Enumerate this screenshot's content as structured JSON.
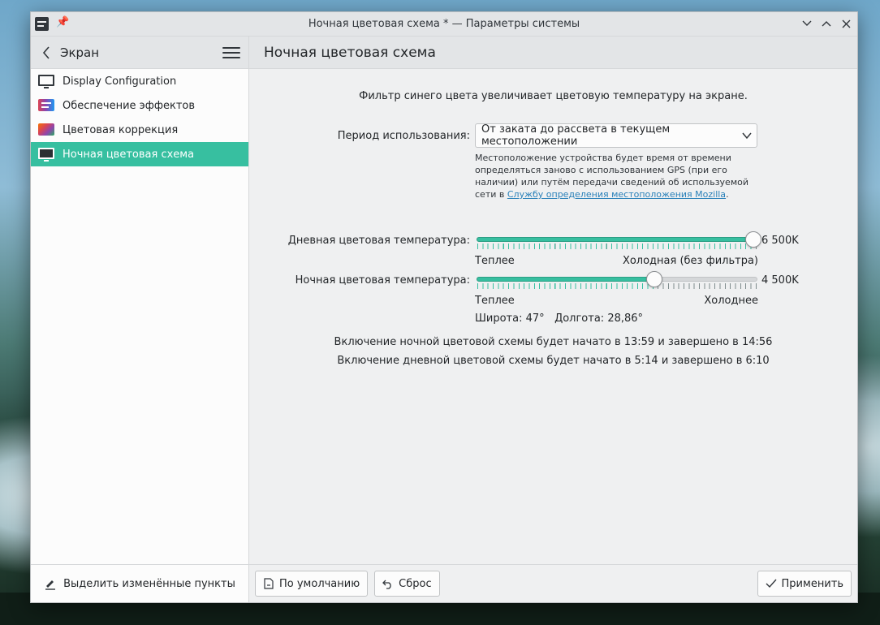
{
  "window": {
    "title": "Ночная цветовая схема * — Параметры системы"
  },
  "sidebar": {
    "back_title": "Экран",
    "items": [
      {
        "label": "Display Configuration",
        "icon": "monitor-icon"
      },
      {
        "label": "Обеспечение эффектов",
        "icon": "effects-icon"
      },
      {
        "label": "Цветовая коррекция",
        "icon": "color-correction-icon"
      },
      {
        "label": "Ночная цветовая схема",
        "icon": "monitor-icon",
        "active": true
      }
    ],
    "footer_button": "Выделить изменённые пункты"
  },
  "main": {
    "page_title": "Ночная цветовая схема",
    "description": "Фильтр синего цвета увеличивает цветовую температуру на экране.",
    "period_label": "Период использования:",
    "period_value": "От заката до рассвета в текущем местоположении",
    "location_note": "Местоположение устройства будет время от времени определяться заново с использованием GPS (при его наличии) или путём передачи сведений об используемой сети в",
    "location_link": "Службу определения местоположения Mozilla",
    "location_period": ".",
    "day_temp": {
      "label": "Дневная цветовая температура:",
      "value_text": "6 500K",
      "value": 6500,
      "min": 1000,
      "max": 6500,
      "left_caption": "Теплее",
      "right_caption": "Холодная (без фильтра)"
    },
    "night_temp": {
      "label": "Ночная цветовая температура:",
      "value_text": "4 500K",
      "value": 4500,
      "min": 1000,
      "max": 6500,
      "left_caption": "Теплее",
      "right_caption": "Холоднее"
    },
    "latitude": "Широта: 47°",
    "longitude": "Долгота: 28,86°",
    "night_schedule": "Включение ночной цветовой схемы будет начато в 13:59 и завершено в 14:56",
    "day_schedule": "Включение дневной цветовой схемы будет начато в 5:14 и завершено в 6:10",
    "buttons": {
      "defaults": "По умолчанию",
      "reset": "Сброс",
      "apply": "Применить"
    }
  },
  "colors": {
    "accent": "#37bfa0",
    "link": "#2980b9"
  }
}
